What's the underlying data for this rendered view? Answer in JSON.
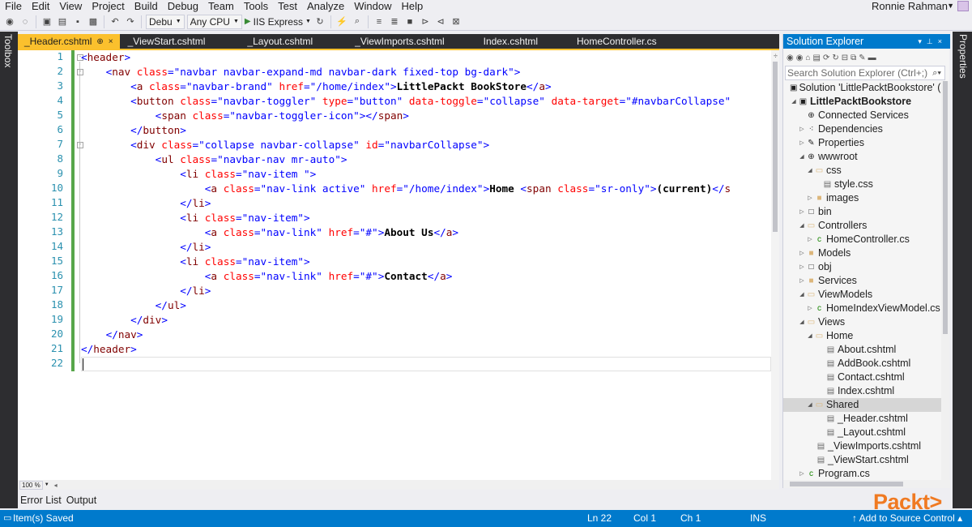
{
  "menu": [
    "File",
    "Edit",
    "View",
    "Project",
    "Build",
    "Debug",
    "Team",
    "Tools",
    "Test",
    "Analyze",
    "Window",
    "Help"
  ],
  "user": {
    "name": "Ronnie Rahman"
  },
  "toolbar": {
    "config": "Debu",
    "platform": "Any CPU",
    "run_target": "IIS Express"
  },
  "side_strips": {
    "left": "Toolbox",
    "right": "Properties"
  },
  "tabs": [
    {
      "label": "_Header.cshtml",
      "active": true
    },
    {
      "label": "_ViewStart.cshtml"
    },
    {
      "label": "_Layout.cshtml"
    },
    {
      "label": "_ViewImports.cshtml"
    },
    {
      "label": "Index.cshtml"
    },
    {
      "label": "HomeController.cs"
    }
  ],
  "tab_glyphs": {
    "pin": "⊕",
    "close": "×"
  },
  "editor": {
    "line_numbers": [
      "1",
      "2",
      "3",
      "4",
      "5",
      "6",
      "7",
      "8",
      "9",
      "10",
      "11",
      "12",
      "13",
      "14",
      "15",
      "16",
      "17",
      "18",
      "19",
      "20",
      "21",
      "22"
    ],
    "zoom": "100 %"
  },
  "code": {
    "l1_open": "<",
    "l1_tag": "header",
    "l1_close": ">",
    "l2_indent": "    ",
    "l2_open": "<",
    "l2_tag": "nav",
    "l2_attr": " class",
    "l2_eq": "=",
    "l2_val": "\"navbar navbar-expand-md navbar-dark fixed-top bg-dark\"",
    "l2_close": ">",
    "l3_indent": "        ",
    "l3_open": "<",
    "l3_tag": "a",
    "l3_attr1": " class",
    "l3_eq1": "=",
    "l3_val1": "\"navbar-brand\"",
    "l3_attr2": " href",
    "l3_eq2": "=",
    "l3_val2": "\"/home/index\"",
    "l3_close": ">",
    "l3_text": "LittlePackt BookStore",
    "l3_endopen": "</",
    "l3_endtag": "a",
    "l3_endclose": ">",
    "l4_indent": "        ",
    "l4_open": "<",
    "l4_tag": "button",
    "l4_attr1": " class",
    "l4_eq1": "=",
    "l4_val1": "\"navbar-toggler\"",
    "l4_attr2": " type",
    "l4_eq2": "=",
    "l4_val2": "\"button\"",
    "l4_attr3": " data-toggle",
    "l4_eq3": "=",
    "l4_val3": "\"collapse\"",
    "l4_attr4": " data-target",
    "l4_eq4": "=",
    "l4_val4": "\"#navbarCollapse\"",
    "l5_indent": "            ",
    "l5_open": "<",
    "l5_tag": "span",
    "l5_attr": " class",
    "l5_eq": "=",
    "l5_val": "\"navbar-toggler-icon\"",
    "l5_close": "></",
    "l5_endtag": "span",
    "l5_endclose": ">",
    "l6_indent": "        ",
    "l6_open": "</",
    "l6_tag": "button",
    "l6_close": ">",
    "l7_indent": "        ",
    "l7_open": "<",
    "l7_tag": "div",
    "l7_attr1": " class",
    "l7_eq1": "=",
    "l7_val1": "\"collapse navbar-collapse\"",
    "l7_attr2": " id",
    "l7_eq2": "=",
    "l7_val2": "\"navbarCollapse\"",
    "l7_close": ">",
    "l8_indent": "            ",
    "l8_open": "<",
    "l8_tag": "ul",
    "l8_attr": " class",
    "l8_eq": "=",
    "l8_val": "\"navbar-nav mr-auto\"",
    "l8_close": ">",
    "l9_indent": "                ",
    "l9_open": "<",
    "l9_tag": "li",
    "l9_attr": " class",
    "l9_eq": "=",
    "l9_val": "\"nav-item \"",
    "l9_close": ">",
    "l10_indent": "                    ",
    "l10_open": "<",
    "l10_tag": "a",
    "l10_attr1": " class",
    "l10_eq1": "=",
    "l10_val1": "\"nav-link active\"",
    "l10_attr2": " href",
    "l10_eq2": "=",
    "l10_val2": "\"/home/index\"",
    "l10_close": ">",
    "l10_text": "Home ",
    "l10_open2": "<",
    "l10_tag2": "span",
    "l10_attr3": " class",
    "l10_eq3": "=",
    "l10_val3": "\"sr-only\"",
    "l10_close2": ">",
    "l10_text2": "(current)",
    "l10_endopen": "</",
    "l10_endtag": "s",
    "l11_indent": "                ",
    "l11_open": "</",
    "l11_tag": "li",
    "l11_close": ">",
    "l12_indent": "                ",
    "l12_open": "<",
    "l12_tag": "li",
    "l12_attr": " class",
    "l12_eq": "=",
    "l12_val": "\"nav-item\"",
    "l12_close": ">",
    "l13_indent": "                    ",
    "l13_open": "<",
    "l13_tag": "a",
    "l13_attr1": " class",
    "l13_eq1": "=",
    "l13_val1": "\"nav-link\"",
    "l13_attr2": " href",
    "l13_eq2": "=",
    "l13_val2": "\"#\"",
    "l13_close": ">",
    "l13_text": "About Us",
    "l13_endopen": "</",
    "l13_endtag": "a",
    "l13_endclose": ">",
    "l14_indent": "                ",
    "l14_open": "</",
    "l14_tag": "li",
    "l14_close": ">",
    "l15_indent": "                ",
    "l15_open": "<",
    "l15_tag": "li",
    "l15_attr": " class",
    "l15_eq": "=",
    "l15_val": "\"nav-item\"",
    "l15_close": ">",
    "l16_indent": "                    ",
    "l16_open": "<",
    "l16_tag": "a",
    "l16_attr1": " class",
    "l16_eq1": "=",
    "l16_val1": "\"nav-link\"",
    "l16_attr2": " href",
    "l16_eq2": "=",
    "l16_val2": "\"#\"",
    "l16_close": ">",
    "l16_text": "Contact",
    "l16_endopen": "</",
    "l16_endtag": "a",
    "l16_endclose": ">",
    "l17_indent": "                ",
    "l17_open": "</",
    "l17_tag": "li",
    "l17_close": ">",
    "l18_indent": "            ",
    "l18_open": "</",
    "l18_tag": "ul",
    "l18_close": ">",
    "l19_indent": "        ",
    "l19_open": "</",
    "l19_tag": "div",
    "l19_close": ">",
    "l20_indent": "    ",
    "l20_open": "</",
    "l20_tag": "nav",
    "l20_close": ">",
    "l21_open": "</",
    "l21_tag": "header",
    "l21_close": ">"
  },
  "panels": [
    "Error List",
    "Output"
  ],
  "status": {
    "message": "Item(s) Saved",
    "ln": "Ln 22",
    "col": "Col 1",
    "ch": "Ch 1",
    "mode": "INS",
    "source_control": "↑ Add to Source Control ▴"
  },
  "watermark": "Packt>",
  "solution_explorer": {
    "title": "Solution Explorer",
    "search_placeholder": "Search Solution Explorer (Ctrl+;)",
    "tree": [
      {
        "label": "Solution 'LittlePacktBookstore' (1"
      },
      {
        "label": "LittlePacktBookstore"
      },
      {
        "label": "Connected Services"
      },
      {
        "label": "Dependencies"
      },
      {
        "label": "Properties"
      },
      {
        "label": "wwwroot"
      },
      {
        "label": "css"
      },
      {
        "label": "style.css"
      },
      {
        "label": "images"
      },
      {
        "label": "bin"
      },
      {
        "label": "Controllers"
      },
      {
        "label": "HomeController.cs"
      },
      {
        "label": "Models"
      },
      {
        "label": "obj"
      },
      {
        "label": "Services"
      },
      {
        "label": "ViewModels"
      },
      {
        "label": "HomeIndexViewModel.cs"
      },
      {
        "label": "Views"
      },
      {
        "label": "Home"
      },
      {
        "label": "About.cshtml"
      },
      {
        "label": "AddBook.cshtml"
      },
      {
        "label": "Contact.cshtml"
      },
      {
        "label": "Index.cshtml"
      },
      {
        "label": "Shared"
      },
      {
        "label": "_Header.cshtml"
      },
      {
        "label": "_Layout.cshtml"
      },
      {
        "label": "_ViewImports.cshtml"
      },
      {
        "label": "_ViewStart.cshtml"
      },
      {
        "label": "Program.cs"
      }
    ]
  },
  "colors": {
    "accent": "#007acc",
    "active_tab": "#fbc02d",
    "change_margin": "#57a64a",
    "tag": "#800000",
    "attribute": "#ff0000",
    "value": "#0000ff",
    "brand": "#f07a22"
  }
}
